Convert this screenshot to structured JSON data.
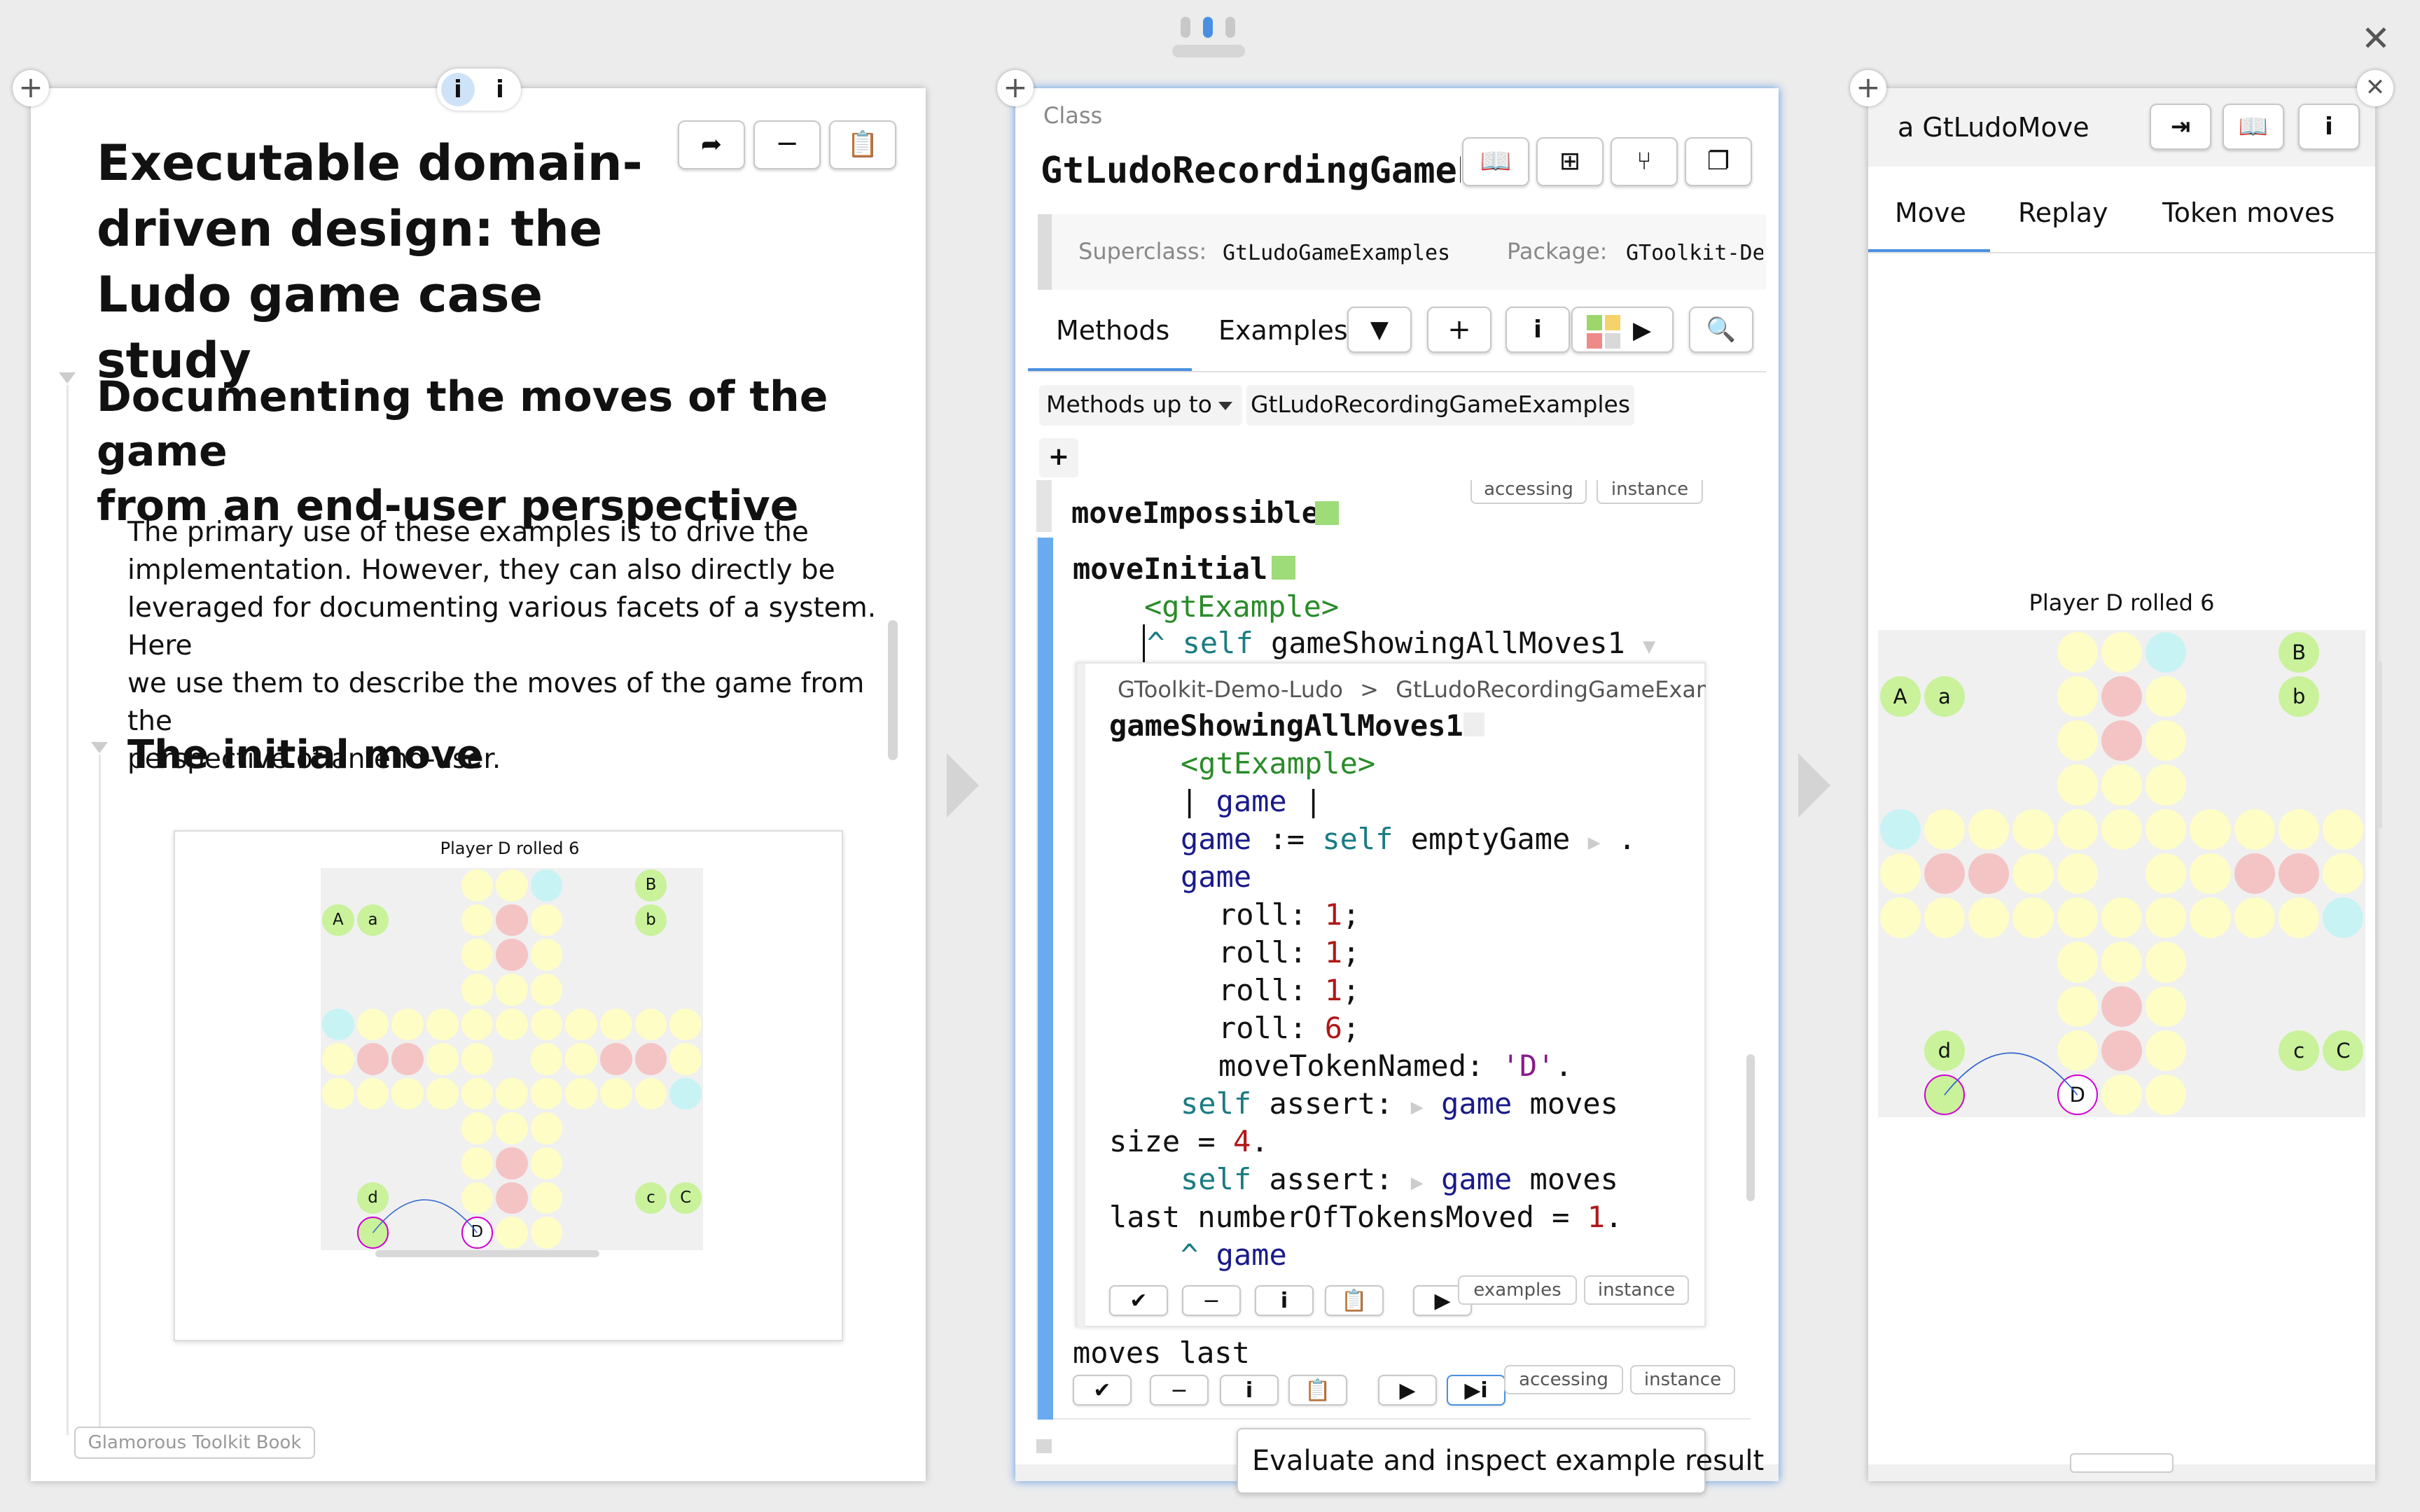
{
  "top_handle": {
    "dots": 3
  },
  "left_pane": {
    "info_chip": "i",
    "main_title": "Executable domain-driven design: the Ludo game case study",
    "title_lines": [
      "Executable domain-",
      "driven design: the",
      "Ludo game case study"
    ],
    "section_title_lines": [
      "Documenting the moves of the game",
      "from an end-user perspective"
    ],
    "paragraph_lines": [
      "The primary use of these examples is to drive the",
      "implementation. However, they can also directly be",
      "leveraged for documenting various facets of a system. Here",
      "we use them to describe the moves of the game from the",
      "perspective of an end-user."
    ],
    "subsection_title": "The initial move",
    "board_caption": "Player D rolled 6",
    "footer_label": "Glamorous Toolkit Book"
  },
  "middle_pane": {
    "kind_label": "Class",
    "class_name": "GtLudoRecordingGameExamples",
    "superclass_label": "Superclass:",
    "superclass_value": "GtLudoGameExamples",
    "package_label": "Package:",
    "package_value": "GToolkit-Demo-Ludo",
    "tabs": [
      "Methods",
      "Examples"
    ],
    "methods_up_to_label": "Methods up to",
    "methods_up_to_value": "GtLudoRecordingGameExamples",
    "add_label": "+",
    "method1": {
      "name": "moveImpossible",
      "tags": [
        "accessing",
        "instance"
      ]
    },
    "method2": {
      "name": "moveInitial",
      "pragma": "<gtExample>",
      "line2_kw": "self",
      "line2_msg": "gameShowingAllMoves1"
    },
    "nested": {
      "breadcrumb_pkg": "GToolkit-Demo-Ludo",
      "breadcrumb_sep": ">",
      "breadcrumb_cls": "GtLudoRecordingGameExamp",
      "method_name": "gameShowingAllMoves1",
      "pragma": "<gtExample>",
      "temp_decl": "game",
      "tags": [
        "examples",
        "instance"
      ]
    },
    "after_nested": "moves last",
    "bottom_tags": [
      "accessing",
      "instance"
    ],
    "tooltip": "Evaluate and inspect example result"
  },
  "right_pane": {
    "title": "a GtLudoMove",
    "tabs": [
      "Move",
      "Replay",
      "Token moves"
    ],
    "board_caption": "Player D rolled 6"
  },
  "board": {
    "tokens_top_left": [
      "A",
      "a"
    ],
    "tokens_top_right": [
      "B",
      "b"
    ],
    "tokens_bottom_left": [
      "d"
    ],
    "tokens_bottom_right": [
      "c",
      "C"
    ],
    "active_token": "D"
  },
  "colors": {
    "accent": "#4a90e2",
    "path": "#fefdc6",
    "home_red": "#f4c4c4",
    "start_cyan": "#c8f3f4",
    "token_green": "#c9f29b",
    "active_ring": "#d000d0",
    "board_bg": "#f0f0f0"
  }
}
